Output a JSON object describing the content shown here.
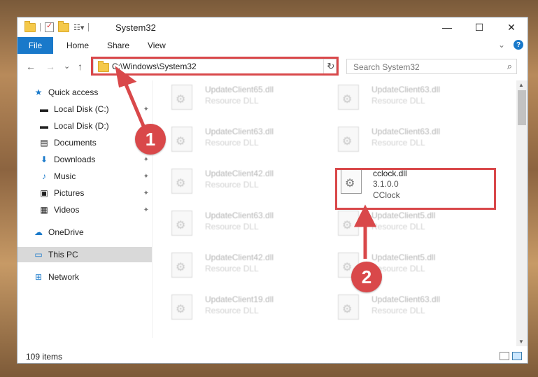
{
  "window": {
    "title": "System32",
    "minimize": "—",
    "maximize": "☐",
    "close": "✕"
  },
  "ribbon": {
    "file": "File",
    "home": "Home",
    "share": "Share",
    "view": "View",
    "collapse": "⌄",
    "help": "?"
  },
  "nav": {
    "back": "←",
    "forward": "→",
    "recent": "⌄",
    "up": "↑",
    "refresh": "↻"
  },
  "address": {
    "path": "C:\\Windows\\System32",
    "dropdown": "⌄"
  },
  "search": {
    "placeholder": "Search System32",
    "icon": "⌕"
  },
  "sidebar": {
    "items": [
      {
        "label": "Quick access"
      },
      {
        "label": "Local Disk (C:)"
      },
      {
        "label": "Local Disk (D:)"
      },
      {
        "label": "Documents"
      },
      {
        "label": "Downloads"
      },
      {
        "label": "Music"
      },
      {
        "label": "Pictures"
      },
      {
        "label": "Videos"
      },
      {
        "label": "OneDrive"
      },
      {
        "label": "This PC"
      },
      {
        "label": "Network"
      }
    ],
    "pin": "📌"
  },
  "files": [
    {
      "name": "UpdateClient65.dll",
      "sub": "Resource DLL"
    },
    {
      "name": "UpdateClient63.dll",
      "sub": "Resource DLL"
    },
    {
      "name": "UpdateClient63.dll",
      "sub": "Resource DLL"
    },
    {
      "name": "UpdateClient63.dll",
      "sub": "Resource DLL"
    },
    {
      "name": "UpdateClient42.dll",
      "sub": "Resource DLL"
    },
    {
      "name": "cclock.dll",
      "version": "3.1.0.0",
      "company": "CClock"
    },
    {
      "name": "UpdateClient63.dll",
      "sub": "Resource DLL"
    },
    {
      "name": "UpdateClient5.dll",
      "sub": "Resource DLL"
    },
    {
      "name": "UpdateClient42.dll",
      "sub": "Resource DLL"
    },
    {
      "name": "UpdateClient5.dll",
      "sub": "Resource DLL"
    },
    {
      "name": "UpdateClient19.dll",
      "sub": "Resource DLL"
    },
    {
      "name": "UpdateClient63.dll",
      "sub": "Resource DLL"
    }
  ],
  "status": {
    "count": "109 items"
  },
  "annotations": {
    "step1": "1",
    "step2": "2",
    "color": "#d9484a"
  }
}
